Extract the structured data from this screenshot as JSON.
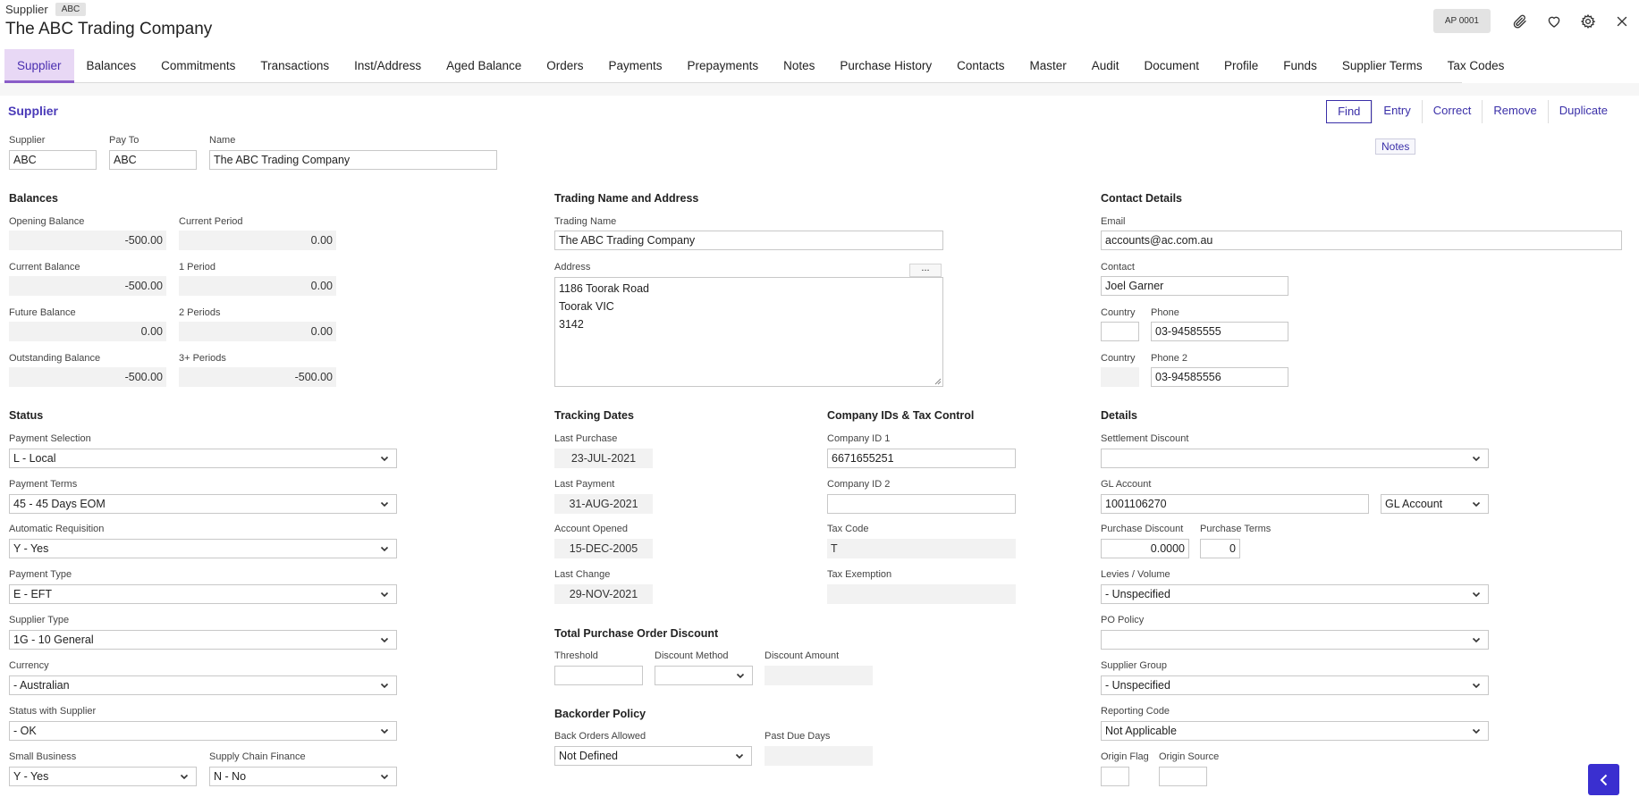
{
  "header": {
    "crumb": "Supplier",
    "crumb_tag": "ABC",
    "title": "The ABC Trading Company",
    "ap_badge": "AP 0001",
    "icons": [
      "paperclip-icon",
      "heart-icon",
      "gear-icon",
      "close-icon"
    ]
  },
  "tabs": [
    "Supplier",
    "Balances",
    "Commitments",
    "Transactions",
    "Inst/Address",
    "Aged Balance",
    "Orders",
    "Payments",
    "Prepayments",
    "Notes",
    "Purchase History",
    "Contacts",
    "Master",
    "Audit",
    "Document",
    "Profile",
    "Funds",
    "Supplier Terms",
    "Tax Codes"
  ],
  "section_link": "Supplier",
  "actions": {
    "find": "Find",
    "entry": "Entry",
    "correct": "Correct",
    "remove": "Remove",
    "duplicate": "Duplicate"
  },
  "notes_button": "Notes",
  "ident": {
    "supplier_label": "Supplier",
    "supplier": "ABC",
    "payto_label": "Pay To",
    "payto": "ABC",
    "name_label": "Name",
    "name": "The ABC Trading Company"
  },
  "balances": {
    "heading": "Balances",
    "opening_label": "Opening Balance",
    "opening": "-500.00",
    "current_period_label": "Current Period",
    "current_period": "0.00",
    "current_label": "Current Balance",
    "current": "-500.00",
    "p1_label": "1 Period",
    "p1": "0.00",
    "future_label": "Future Balance",
    "future": "0.00",
    "p2_label": "2 Periods",
    "p2": "0.00",
    "outstanding_label": "Outstanding Balance",
    "outstanding": "-500.00",
    "p3_label": "3+ Periods",
    "p3": "-500.00"
  },
  "trading": {
    "heading": "Trading Name and Address",
    "trading_name_label": "Trading Name",
    "trading_name": "The ABC Trading Company",
    "address_label": "Address",
    "address_lines": [
      "1186 Toorak Road",
      "Toorak VIC",
      "3142"
    ],
    "dots": "..."
  },
  "contact": {
    "heading": "Contact Details",
    "email_label": "Email",
    "email": "accounts@ac.com.au",
    "contact_label": "Contact",
    "contact": "Joel Garner",
    "country_label": "Country",
    "phone_label": "Phone",
    "phone": "03-94585555",
    "country2_label": "Country",
    "phone2_label": "Phone 2",
    "phone2": "03-94585556"
  },
  "status": {
    "heading": "Status",
    "payment_selection_label": "Payment Selection",
    "payment_selection": "L - Local",
    "payment_terms_label": "Payment Terms",
    "payment_terms": "45 - 45 Days EOM",
    "auto_req_label": "Automatic Requisition",
    "auto_req": "Y - Yes",
    "payment_type_label": "Payment Type",
    "payment_type": "E - EFT",
    "supplier_type_label": "Supplier Type",
    "supplier_type": "1G - 10 General",
    "currency_label": "Currency",
    "currency": "- Australian",
    "status_label": "Status with Supplier",
    "status_value": "- OK",
    "small_business_label": "Small Business",
    "small_business": "Y - Yes",
    "supply_chain_label": "Supply Chain Finance",
    "supply_chain": "N - No"
  },
  "tracking": {
    "heading": "Tracking Dates",
    "last_purchase_label": "Last Purchase",
    "last_purchase": "23-JUL-2021",
    "last_payment_label": "Last Payment",
    "last_payment": "31-AUG-2021",
    "account_opened_label": "Account Opened",
    "account_opened": "15-DEC-2005",
    "last_change_label": "Last Change",
    "last_change": "29-NOV-2021"
  },
  "company_ids": {
    "heading": "Company IDs & Tax Control",
    "id1_label": "Company ID 1",
    "id1": "6671655251",
    "id2_label": "Company ID 2",
    "id2": "",
    "tax_code_label": "Tax Code",
    "tax_code": "T",
    "tax_exemption_label": "Tax Exemption",
    "tax_exemption": ""
  },
  "discount": {
    "heading": "Total Purchase Order Discount",
    "threshold_label": "Threshold",
    "threshold": "",
    "method_label": "Discount Method",
    "method": "",
    "amount_label": "Discount Amount",
    "amount": ""
  },
  "backorder": {
    "heading": "Backorder Policy",
    "allowed_label": "Back Orders Allowed",
    "allowed": "Not Defined",
    "past_due_label": "Past Due Days",
    "past_due": ""
  },
  "details": {
    "heading": "Details",
    "settlement_label": "Settlement Discount",
    "settlement": "",
    "gl_label": "GL Account",
    "gl": "1001106270",
    "gl_type": "GL Account",
    "purchase_discount_label": "Purchase Discount",
    "purchase_discount": "0.0000",
    "purchase_terms_label": "Purchase Terms",
    "purchase_terms": "0",
    "levies_label": "Levies / Volume",
    "levies": "- Unspecified",
    "po_policy_label": "PO Policy",
    "po_policy": "",
    "group_label": "Supplier Group",
    "group": "- Unspecified",
    "reporting_label": "Reporting Code",
    "reporting": "Not Applicable",
    "origin_flag_label": "Origin Flag",
    "origin_flag": "",
    "origin_source_label": "Origin Source",
    "origin_source": ""
  },
  "colors": {
    "accent": "#4a2fb0",
    "tab_active_bg": "#e8d8f5",
    "fab": "#3a2fd0"
  }
}
